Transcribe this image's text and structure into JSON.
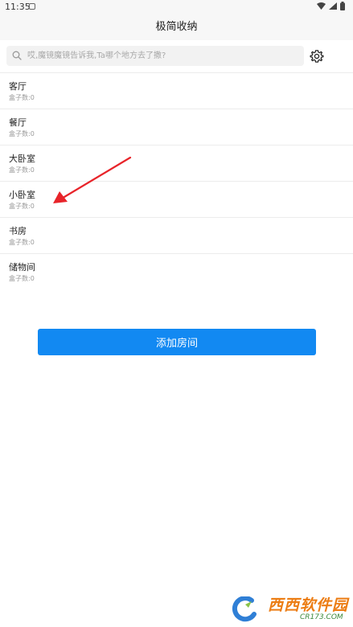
{
  "status_bar": {
    "time": "11:35",
    "icons": [
      "notification-icon",
      "wifi-icon",
      "signal-icon",
      "battery-icon"
    ]
  },
  "app_bar": {
    "title": "极简收纳"
  },
  "search": {
    "placeholder": "哎,魔镜魔镜告诉我,Ta哪个地方去了撒?",
    "value": ""
  },
  "settings_icon": "gear-icon",
  "rooms": [
    {
      "name": "客厅",
      "count_label": "盒子数:",
      "count": "0"
    },
    {
      "name": "餐厅",
      "count_label": "盒子数:",
      "count": "0"
    },
    {
      "name": "大卧室",
      "count_label": "盒子数:",
      "count": "0"
    },
    {
      "name": "小卧室",
      "count_label": "盒子数:",
      "count": "0"
    },
    {
      "name": "书房",
      "count_label": "盒子数:",
      "count": "0"
    },
    {
      "name": "储物间",
      "count_label": "盒子数:",
      "count": "0"
    }
  ],
  "add_room_button": "添加房间",
  "colors": {
    "primary": "#1289f2",
    "arrow": "#e8242a",
    "divider": "#ececec",
    "header_bg": "#f7f7f7",
    "search_bg": "#f2f2f2"
  },
  "watermark": {
    "text_cn": "西西软件园",
    "text_en": "CR173.COM"
  }
}
